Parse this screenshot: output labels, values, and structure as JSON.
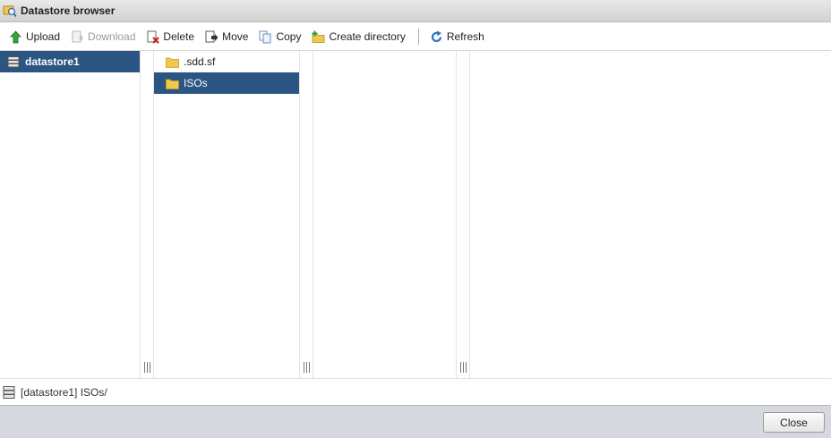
{
  "window": {
    "title": "Datastore browser"
  },
  "toolbar": {
    "upload": "Upload",
    "download": "Download",
    "delete": "Delete",
    "move": "Move",
    "copy": "Copy",
    "create_directory": "Create directory",
    "refresh": "Refresh"
  },
  "datastores": [
    {
      "label": "datastore1",
      "selected": true
    }
  ],
  "column1": [
    {
      "label": ".sdd.sf",
      "selected": false
    },
    {
      "label": "ISOs",
      "selected": true
    }
  ],
  "status": {
    "path": "[datastore1] ISOs/"
  },
  "footer": {
    "close_label": "Close"
  },
  "colors": {
    "selection": "#2b5582",
    "footer_bg": "#d5d8dc",
    "folder": "#f0c94c"
  }
}
